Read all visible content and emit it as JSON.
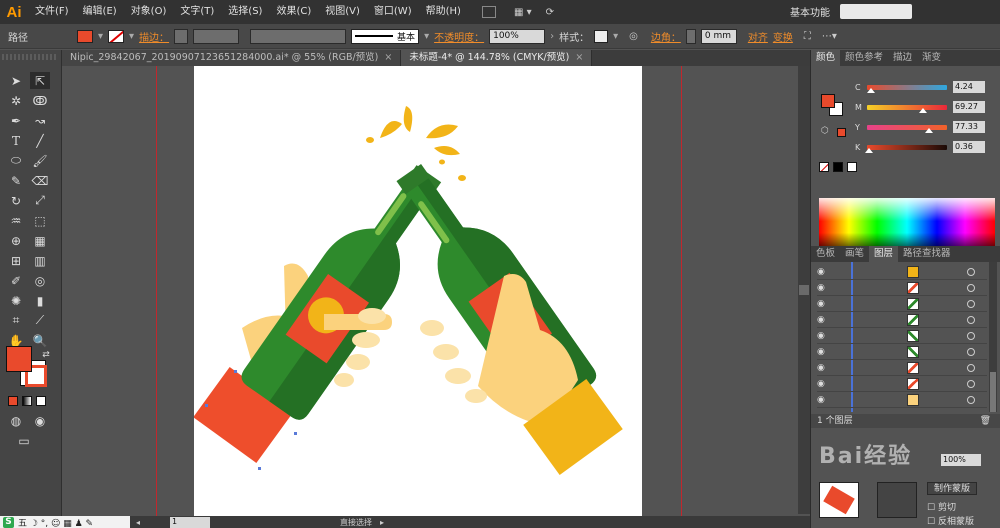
{
  "app": {
    "logo": "Ai",
    "workspace": "基本功能"
  },
  "menu": [
    "文件(F)",
    "编辑(E)",
    "对象(O)",
    "文字(T)",
    "选择(S)",
    "效果(C)",
    "视图(V)",
    "窗口(W)",
    "帮助(H)"
  ],
  "control": {
    "object_type": "路径",
    "stroke_label": "描边：",
    "stroke_style": "基本",
    "opacity_label": "不透明度：",
    "opacity_value": "100%",
    "style_label": "样式：",
    "corner_label": "边角：",
    "corner_value": "0 mm",
    "align": "对齐",
    "transform": "变换",
    "fill_color": "#e94a2c"
  },
  "tabs": [
    {
      "label": "Nipic_29842067_20190907123651284000.ai* @ 55% (RGB/预览)",
      "close": "×"
    },
    {
      "label": "未标题-4* @ 144.78% (CMYK/预览)",
      "close": "×"
    }
  ],
  "color_panel": {
    "tabs": [
      "颜色",
      "颜色参考",
      "描边",
      "渐变"
    ],
    "channels": [
      {
        "letter": "C",
        "value": "4.24",
        "pos": 0.04
      },
      {
        "letter": "M",
        "value": "69.27",
        "pos": 0.69
      },
      {
        "letter": "Y",
        "value": "77.33",
        "pos": 0.77
      },
      {
        "letter": "K",
        "value": "0.36",
        "pos": 0.0
      }
    ]
  },
  "layers_panel": {
    "tabs": [
      "色板",
      "画笔",
      "图层",
      "路径查找器"
    ],
    "footer": "1 个图层",
    "rows": 9
  },
  "transparency": {
    "watermark": "Bai经验",
    "opacity": "100%",
    "make_mask": "制作蒙版",
    "clip": "剪切",
    "invert_mask": "反相蒙版"
  },
  "status": {
    "zoom": "1",
    "tool": "直接选择"
  },
  "ime": {
    "logo": "S",
    "text": "五 ☽ °, ☺ ▦ ♟ ✎"
  }
}
